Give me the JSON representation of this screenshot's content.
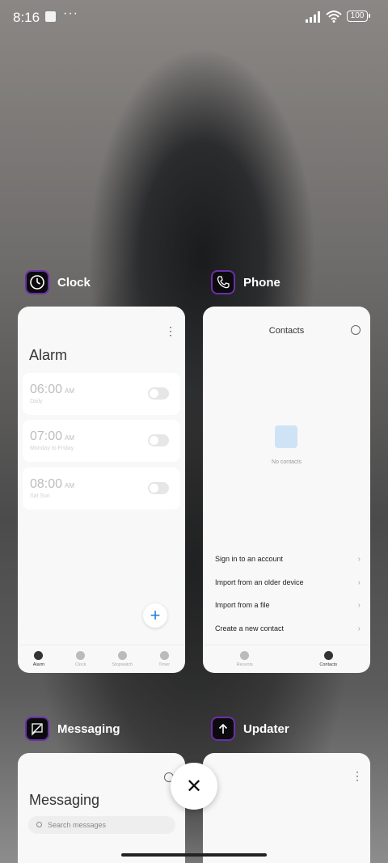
{
  "status": {
    "time": "8:16",
    "dots": "···",
    "battery": "100"
  },
  "apps": {
    "clock": {
      "name": "Clock",
      "screen_title": "Alarm",
      "alarms": [
        {
          "time": "06:00",
          "ampm": "AM",
          "repeat": "Daily"
        },
        {
          "time": "07:00",
          "ampm": "AM",
          "repeat": "Monday to Friday"
        },
        {
          "time": "08:00",
          "ampm": "AM",
          "repeat": "Sat Sun"
        }
      ],
      "add_label": "+",
      "nav": [
        "Alarm",
        "Clock",
        "Stopwatch",
        "Timer"
      ]
    },
    "phone": {
      "name": "Phone",
      "screen_title": "Contacts",
      "empty_text": "No contacts",
      "actions": [
        "Sign in to an account",
        "Import from an older device",
        "Import from a file",
        "Create a new contact"
      ],
      "nav": [
        "Recents",
        "Contacts"
      ]
    },
    "messaging": {
      "name": "Messaging",
      "screen_title": "Messaging",
      "search_placeholder": "Search messages"
    },
    "updater": {
      "name": "Updater"
    }
  },
  "controls": {
    "close_symbol": "✕"
  },
  "colors": {
    "icon_border": "#6b2fa8",
    "accent": "#2a7de1"
  }
}
